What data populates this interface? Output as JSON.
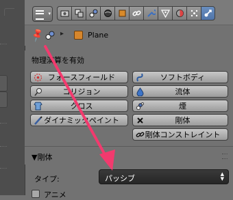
{
  "header": {
    "editor_type_icon": "editor-type-icon",
    "context_tabs": [
      {
        "icon": "render-icon",
        "active": false
      },
      {
        "icon": "render-layers-icon",
        "active": false
      },
      {
        "icon": "scene-icon",
        "active": false
      },
      {
        "icon": "world-icon",
        "active": false
      },
      {
        "icon": "object-icon",
        "active": false
      },
      {
        "icon": "constraints-icon",
        "active": false
      },
      {
        "icon": "modifiers-icon",
        "active": false
      },
      {
        "icon": "data-icon",
        "active": false
      },
      {
        "icon": "material-icon",
        "active": false
      },
      {
        "icon": "particles-icon",
        "active": false
      },
      {
        "icon": "physics-icon",
        "active": true
      }
    ]
  },
  "breadcrumb": {
    "pin_icon": "pin-icon",
    "scene_icon": "scene-icon",
    "separator": "▸",
    "object_name": "Plane"
  },
  "physics_panel": {
    "title": "物理演算を有効",
    "buttons_left": [
      {
        "label": "フォースフィールド",
        "icon": "force-field-icon"
      },
      {
        "label": "コリジョン",
        "icon": "collision-icon"
      },
      {
        "label": "クロス",
        "icon": "cloth-icon"
      },
      {
        "label": "ダイナミックペイント",
        "icon": "dynamic-paint-icon"
      }
    ],
    "buttons_right": [
      {
        "label": "ソフトボディ",
        "icon": "soft-body-icon"
      },
      {
        "label": "流体",
        "icon": "fluid-icon"
      },
      {
        "label": "煙",
        "icon": "smoke-icon"
      },
      {
        "label": "剛体",
        "icon": "close-icon"
      },
      {
        "label": "剛体コンストレイント",
        "icon": "link-icon"
      }
    ]
  },
  "rigid_body": {
    "collapse_arrow": "▼",
    "title": "剛体",
    "type_label": "タイプ:",
    "type_value": "パッシブ",
    "animated_label": "アニメ"
  },
  "colors": {
    "annotation_arrow": "#f23a6e",
    "active_tab": "#5a7fb4"
  }
}
